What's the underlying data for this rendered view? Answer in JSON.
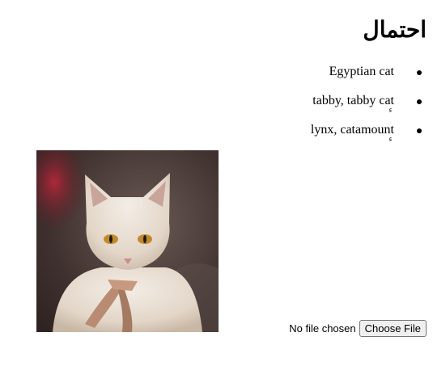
{
  "heading": "احتمال",
  "predictions": [
    {
      "label": "Egyptian cat",
      "mark": ""
    },
    {
      "label": "tabby, tabby cat",
      "mark": "ء"
    },
    {
      "label": "lynx, catamount",
      "mark": "ء"
    }
  ],
  "image": {
    "subject": "white-cat-photo"
  },
  "file_input": {
    "status": "No file chosen",
    "button_label": "Choose File"
  }
}
